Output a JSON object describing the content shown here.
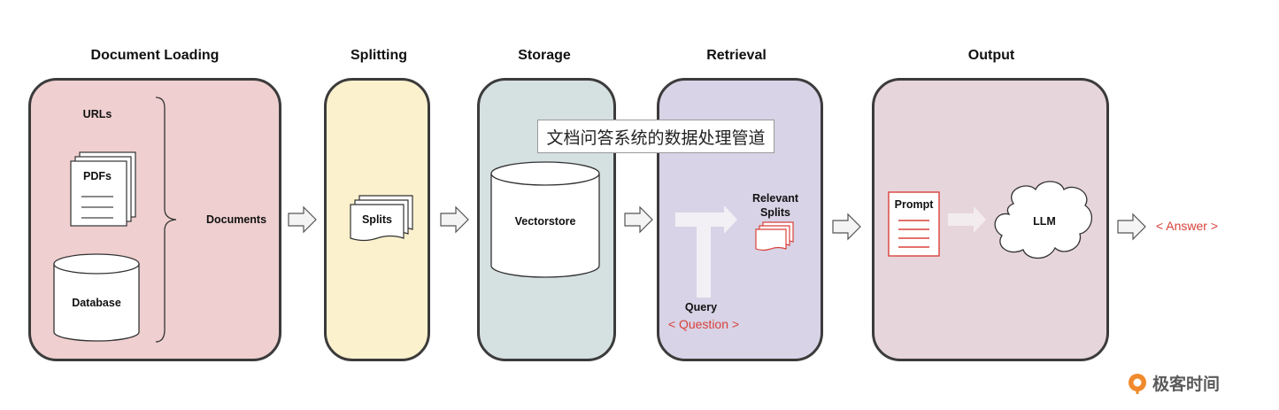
{
  "stages": {
    "loading": "Document Loading",
    "splitting": "Splitting",
    "storage": "Storage",
    "retrieval": "Retrieval",
    "output": "Output"
  },
  "loading": {
    "urls": "URLs",
    "pdfs": "PDFs",
    "database": "Database",
    "documents": "Documents"
  },
  "splitting": {
    "splits": "Splits"
  },
  "storage": {
    "vectorstore": "Vectorstore"
  },
  "retrieval": {
    "relevant_line1": "Relevant",
    "relevant_line2": "Splits",
    "query": "Query",
    "question": "< Question >"
  },
  "output": {
    "prompt": "Prompt",
    "llm": "LLM",
    "answer": "< Answer >"
  },
  "caption": "文档问答系统的数据处理管道",
  "brand": {
    "name": "极客时间"
  },
  "colors": {
    "loading": "#efcfcf",
    "splitting": "#fbf1cd",
    "storage": "#d5e0e1",
    "retrieval": "#d8d3e6",
    "output": "#e7d5dc",
    "accent": "#d8423a"
  }
}
